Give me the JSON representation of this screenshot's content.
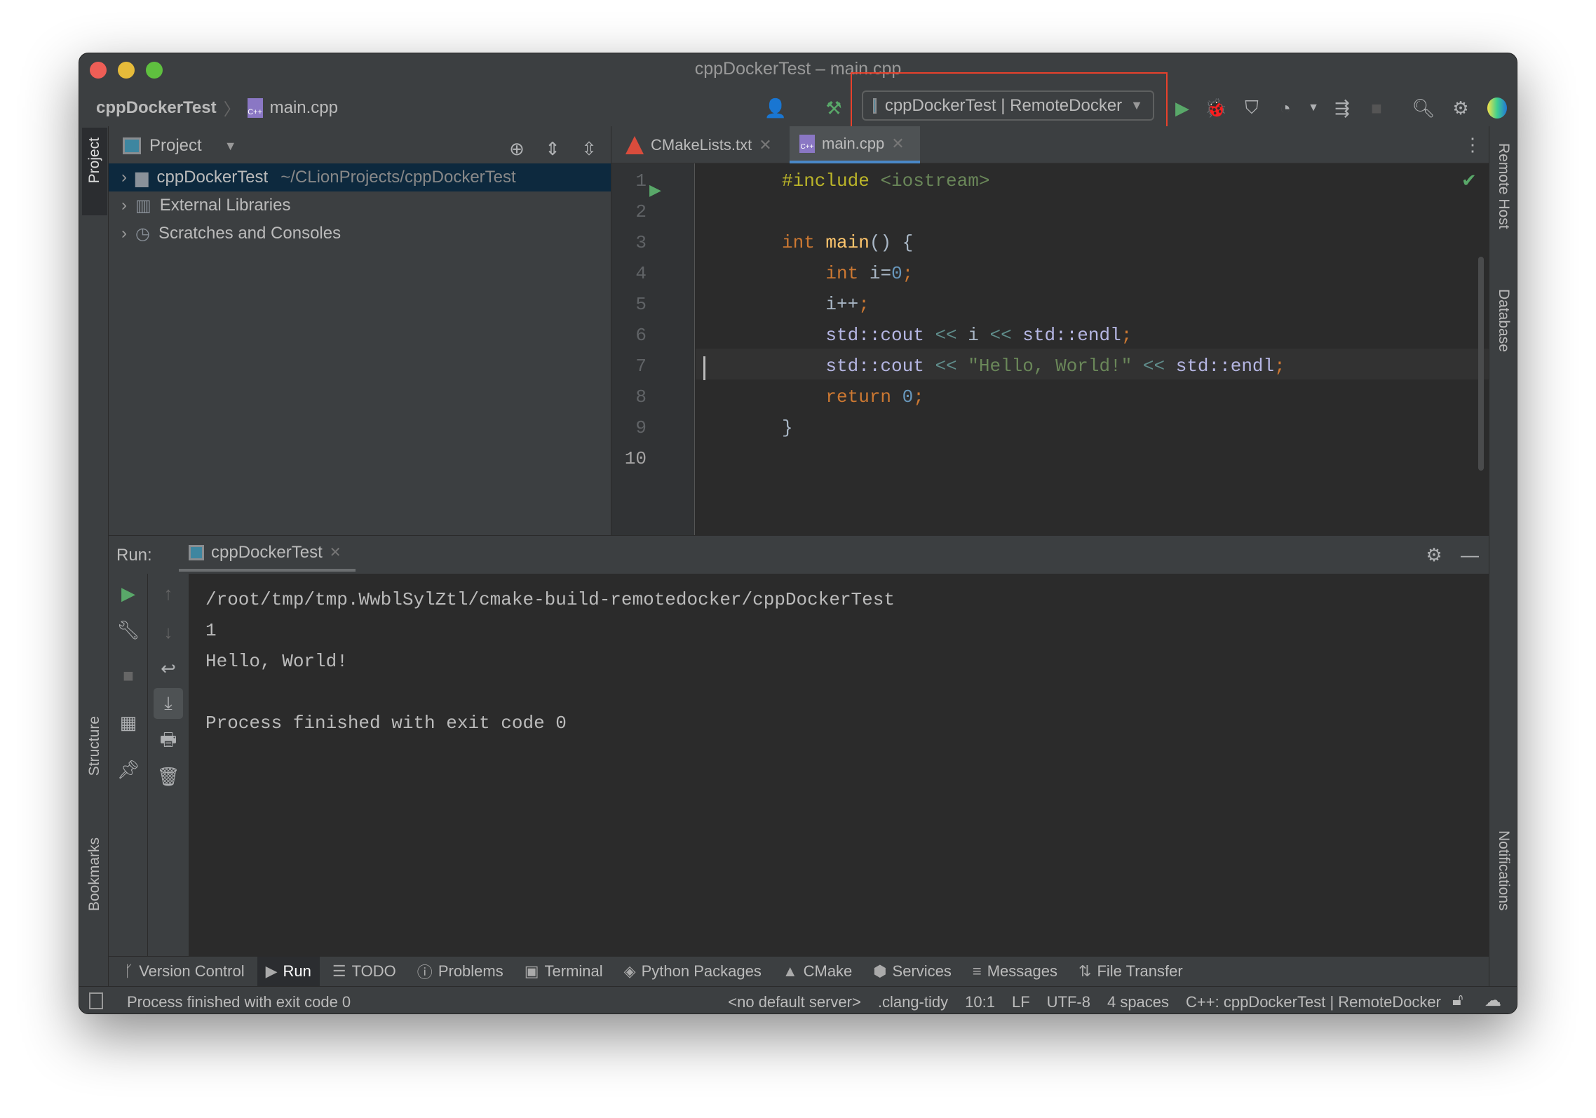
{
  "window": {
    "title": "cppDockerTest – main.cpp"
  },
  "breadcrumb": {
    "project": "cppDockerTest",
    "file": "main.cpp"
  },
  "run_config": {
    "label": "cppDockerTest | RemoteDocker"
  },
  "project_panel": {
    "title": "Project",
    "tree": [
      {
        "label": "cppDockerTest",
        "hint": "~/CLionProjects/cppDockerTest",
        "icon": "folder-icon"
      },
      {
        "label": "External Libraries",
        "hint": "",
        "icon": "library-icon"
      },
      {
        "label": "Scratches and Consoles",
        "hint": "",
        "icon": "scratches-icon"
      }
    ]
  },
  "editor": {
    "tabs": [
      {
        "label": "CMakeLists.txt",
        "active": false
      },
      {
        "label": "main.cpp",
        "active": true
      }
    ],
    "lines": [
      {
        "n": "1",
        "tokens": [
          [
            "#include ",
            "pp"
          ],
          [
            "<iostream>",
            "str"
          ]
        ]
      },
      {
        "n": "2",
        "tokens": []
      },
      {
        "n": "3",
        "tokens": [
          [
            "int ",
            "kw"
          ],
          [
            "main",
            "fn"
          ],
          [
            "() {",
            "pl"
          ]
        ]
      },
      {
        "n": "4",
        "tokens": [
          [
            "    ",
            "pl"
          ],
          [
            "int ",
            "kw"
          ],
          [
            "i=",
            "pl"
          ],
          [
            "0",
            "num"
          ],
          [
            ";",
            "semi"
          ]
        ]
      },
      {
        "n": "5",
        "tokens": [
          [
            "    i++",
            "pl"
          ],
          [
            ";",
            "semi"
          ]
        ]
      },
      {
        "n": "6",
        "tokens": [
          [
            "    ",
            "pl"
          ],
          [
            "std::cout ",
            "std"
          ],
          [
            "<< ",
            "op"
          ],
          [
            "i ",
            "pl"
          ],
          [
            "<< ",
            "op"
          ],
          [
            "std::endl",
            "std"
          ],
          [
            ";",
            "semi"
          ]
        ]
      },
      {
        "n": "7",
        "tokens": [
          [
            "    ",
            "pl"
          ],
          [
            "std::cout ",
            "std"
          ],
          [
            "<< ",
            "op"
          ],
          [
            "\"Hello, World!\" ",
            "str"
          ],
          [
            "<< ",
            "op"
          ],
          [
            "std::endl",
            "std"
          ],
          [
            ";",
            "semi"
          ]
        ]
      },
      {
        "n": "8",
        "tokens": [
          [
            "    ",
            "pl"
          ],
          [
            "return ",
            "kw"
          ],
          [
            "0",
            "num"
          ],
          [
            ";",
            "semi"
          ]
        ]
      },
      {
        "n": "9",
        "tokens": [
          [
            "}",
            "pl"
          ]
        ]
      },
      {
        "n": "10",
        "tokens": []
      }
    ]
  },
  "run_panel": {
    "label": "Run:",
    "tab": "cppDockerTest",
    "output": [
      "/root/tmp/tmp.WwblSylZtl/cmake-build-remotedocker/cppDockerTest",
      "1",
      "Hello, World!",
      "",
      "Process finished with exit code 0"
    ]
  },
  "left_stripe": {
    "project": "Project",
    "structure": "Structure",
    "bookmarks": "Bookmarks"
  },
  "right_stripe": {
    "remote_host": "Remote Host",
    "database": "Database",
    "notifications": "Notifications"
  },
  "bottom_tabs": [
    {
      "label": "Version Control",
      "icon": "branch-icon"
    },
    {
      "label": "Run",
      "icon": "run-icon",
      "active": true
    },
    {
      "label": "TODO",
      "icon": "list-icon"
    },
    {
      "label": "Problems",
      "icon": "problems-icon"
    },
    {
      "label": "Terminal",
      "icon": "terminal-icon"
    },
    {
      "label": "Python Packages",
      "icon": "packages-icon"
    },
    {
      "label": "CMake",
      "icon": "cmake-icon"
    },
    {
      "label": "Services",
      "icon": "services-icon"
    },
    {
      "label": "Messages",
      "icon": "messages-icon"
    },
    {
      "label": "File Transfer",
      "icon": "transfer-icon"
    }
  ],
  "status_bar": {
    "message": "Process finished with exit code 0",
    "items": [
      "<no default server>",
      ".clang-tidy",
      "10:1",
      "LF",
      "UTF-8",
      "4 spaces",
      "C++: cppDockerTest | RemoteDocker"
    ]
  },
  "colors": {
    "highlight_box": "#e8412c",
    "accent": "#4a88c7",
    "run_green": "#59a869"
  }
}
